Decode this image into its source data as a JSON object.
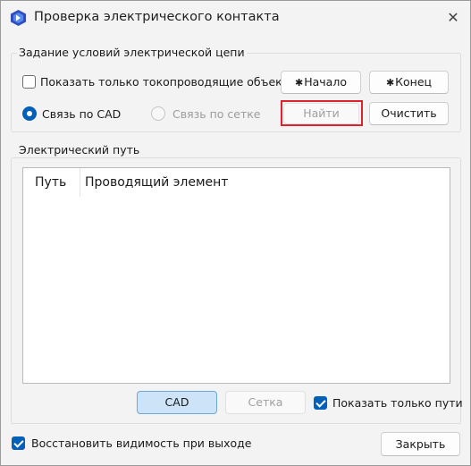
{
  "window": {
    "title": "Проверка электрического контакта",
    "icon": "app-logo-icon",
    "close_icon": "close-icon"
  },
  "conditions": {
    "group_label": "Задание условий электрической цепи",
    "show_conductive_label": "Показать только токопроводящие объекты",
    "show_conductive_checked": false,
    "radio_cad_label": "Связь по CAD",
    "radio_cad_selected": true,
    "radio_grid_label": "Связь по сетке",
    "radio_grid_enabled": false,
    "start_button": "Начало",
    "end_button": "Конец",
    "find_button": "Найти",
    "clear_button": "Очистить"
  },
  "path": {
    "group_label": "Электрический путь",
    "columns": [
      "Путь",
      "Проводящий элемент"
    ],
    "rows": [],
    "cad_button": "CAD",
    "grid_button": "Сетка",
    "show_only_paths_label": "Показать только пути",
    "show_only_paths_checked": true
  },
  "footer": {
    "restore_visibility_label": "Восстановить видимость при выходе",
    "restore_visibility_checked": true,
    "close_button": "Закрыть"
  },
  "colors": {
    "accent": "#005fb8",
    "highlight": "#d9232d",
    "window_bg": "#f3f3f3"
  }
}
